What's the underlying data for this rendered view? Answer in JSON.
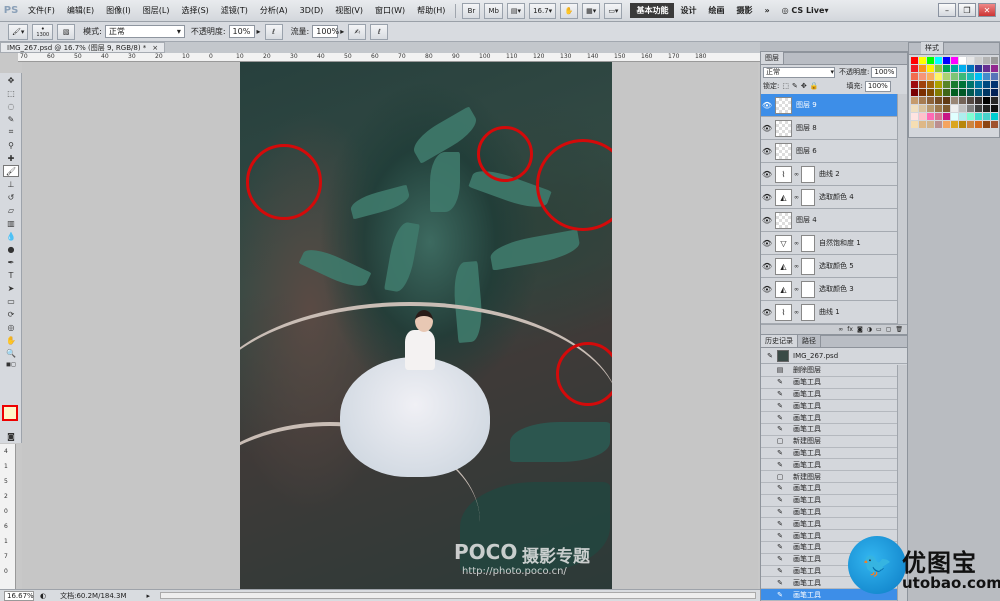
{
  "app": {
    "logo": "PS"
  },
  "menu": [
    "文件(F)",
    "编辑(E)",
    "图像(I)",
    "图层(L)",
    "选择(S)",
    "滤镜(T)",
    "分析(A)",
    "3D(D)",
    "视图(V)",
    "窗口(W)",
    "帮助(H)"
  ],
  "menubar_controls": {
    "br": "Br",
    "mb": "Mb",
    "zoom": "16.7",
    "cs_live": "CS Live"
  },
  "workspaces": {
    "active": "基本功能",
    "items": [
      "设计",
      "绘画",
      "摄影"
    ]
  },
  "options": {
    "brush_size": "1300",
    "mode_label": "模式:",
    "mode_value": "正常",
    "opacity_label": "不透明度:",
    "opacity_value": "10%",
    "flow_label": "流量:",
    "flow_value": "100%"
  },
  "document": {
    "tab": "IMG_267.psd @ 16.7% (图层 9, RGB/8) *",
    "status_zoom": "16.67%",
    "status_doc": "文档:60.2M/184.3M"
  },
  "ruler_h": [
    "70",
    "60",
    "50",
    "40",
    "30",
    "20",
    "10",
    "0",
    "10",
    "20",
    "30",
    "40",
    "50",
    "60",
    "70",
    "80",
    "90",
    "100",
    "110",
    "120",
    "130",
    "140",
    "150",
    "160",
    "170",
    "180"
  ],
  "ruler_v": [
    "4",
    "1",
    "5",
    "2",
    "0",
    "6",
    "1",
    "7",
    "0"
  ],
  "layers_panel": {
    "tabs": [
      "图层"
    ],
    "blend_mode": "正常",
    "opacity_label": "不透明度:",
    "opacity": "100%",
    "lock_label": "锁定:",
    "fill_label": "填充:",
    "fill": "100%",
    "layers": [
      {
        "name": "图层 9",
        "kind": "pixel",
        "selected": true
      },
      {
        "name": "图层 8",
        "kind": "pixel",
        "selected": false
      },
      {
        "name": "图层 6",
        "kind": "pixel",
        "selected": false
      },
      {
        "name": "曲线 2",
        "kind": "curves",
        "selected": false
      },
      {
        "name": "选取颜色 4",
        "kind": "selective",
        "selected": false
      },
      {
        "name": "图层 4",
        "kind": "pixel",
        "selected": false
      },
      {
        "name": "自然饱和度 1",
        "kind": "vibrance",
        "selected": false
      },
      {
        "name": "选取颜色 5",
        "kind": "selective",
        "selected": false
      },
      {
        "name": "选取颜色 3",
        "kind": "selective",
        "selected": false
      },
      {
        "name": "曲线 1",
        "kind": "curves",
        "selected": false
      }
    ]
  },
  "history_panel": {
    "tabs": [
      "历史记录",
      "路径"
    ],
    "source": "IMG_267.psd",
    "items": [
      "删除图层",
      "画笔工具",
      "画笔工具",
      "画笔工具",
      "画笔工具",
      "画笔工具",
      "新建图层",
      "画笔工具",
      "画笔工具",
      "新建图层",
      "画笔工具",
      "画笔工具",
      "画笔工具",
      "画笔工具",
      "画笔工具",
      "画笔工具",
      "画笔工具",
      "画笔工具",
      "画笔工具",
      "画笔工具"
    ],
    "selected_index": 19
  },
  "swatches_panel": {
    "tab": "样式"
  },
  "photo_watermark": {
    "logo": "POCO",
    "text": "摄影专题",
    "url": "http://photo.poco.cn/"
  },
  "site_watermark": {
    "name": "优图宝",
    "url": "utobao.com"
  },
  "colors": {
    "highlight": "#3d8ee8",
    "annotation_red": "#d40a0a",
    "foreground": "#fff6c8"
  }
}
